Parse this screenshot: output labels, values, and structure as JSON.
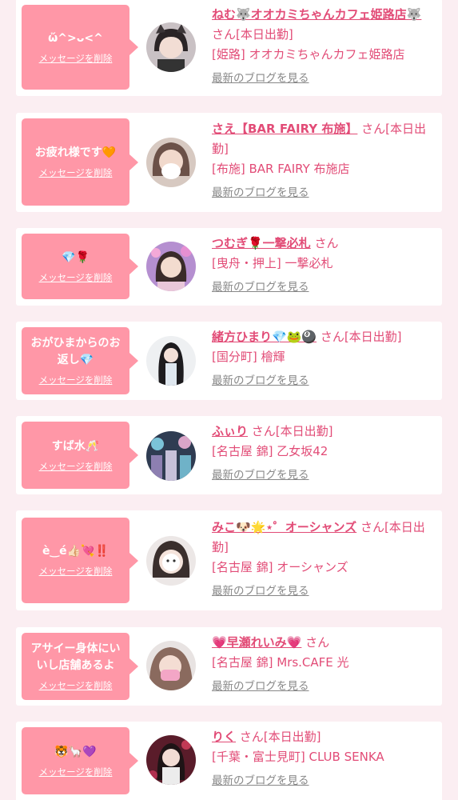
{
  "colors": {
    "background": "#fbeef2",
    "card": "#ffffff",
    "bubble": "#ff97a7",
    "name_text": "#e24c77",
    "link_grey": "#888888"
  },
  "cards": [
    {
      "message": "ὤ^>ᴗ<^",
      "delete_label": "メッセージを削除",
      "name": "ねむ🐺オオカミちゃんカフェ姫路店🐺",
      "suffix": "さん[本日出勤]",
      "shop": "[姫路] オオカミちゃんカフェ姫路店",
      "blog_label": "最新のブログを見る",
      "avatar_icon": "girl-portrait-icon"
    },
    {
      "message": "お疲れ様です🧡",
      "delete_label": "メッセージを削除",
      "name": "さえ【BAR FAIRY 布施】",
      "suffix": "さん[本日出勤]",
      "shop": "[布施] BAR FAIRY 布施店",
      "blog_label": "最新のブログを見る",
      "avatar_icon": "girl-portrait-icon"
    },
    {
      "message": "💎🌹",
      "delete_label": "メッセージを削除",
      "name": "つむぎ🌹一撃必札",
      "suffix": "さん",
      "shop": "[曳舟・押上] 一撃必札",
      "blog_label": "最新のブログを見る",
      "avatar_icon": "girl-portrait-icon"
    },
    {
      "message": "おがひまからのお返し💎",
      "delete_label": "メッセージを削除",
      "name": "緒方ひまり💎🐸🎱",
      "suffix": "さん[本日出勤]",
      "shop": "[国分町] 檜輝",
      "blog_label": "最新のブログを見る",
      "avatar_icon": "girl-portrait-icon"
    },
    {
      "message": "すば水🥂",
      "delete_label": "メッセージを削除",
      "name": "ふぃり",
      "suffix": "さん[本日出勤]",
      "shop": "[名古屋 錦] 乙女坂42",
      "blog_label": "最新のブログを見る",
      "avatar_icon": "girl-portrait-icon"
    },
    {
      "message": "è‿é👍🏻💘‼️",
      "delete_label": "メッセージを削除",
      "name": "みこ🐶🌟⋆゜オーシャンズ",
      "suffix": "さん[本日出勤]",
      "shop": "[名古屋 錦] オーシャンズ",
      "blog_label": "最新のブログを見る",
      "avatar_icon": "girl-portrait-icon"
    },
    {
      "message": "アサイー身体にいいし店舗あるよ",
      "delete_label": "メッセージを削除",
      "name": "💗早瀬れいみ💗",
      "suffix": "さん",
      "shop": "[名古屋 錦] Mrs.CAFE 光",
      "blog_label": "最新のブログを見る",
      "avatar_icon": "girl-portrait-icon"
    },
    {
      "message": "🐯🦙💜",
      "delete_label": "メッセージを削除",
      "name": "りく",
      "suffix": "さん[本日出勤]",
      "shop": "[千葉・富士見町] CLUB SENKA",
      "blog_label": "最新のブログを見る",
      "avatar_icon": "girl-portrait-icon"
    }
  ]
}
